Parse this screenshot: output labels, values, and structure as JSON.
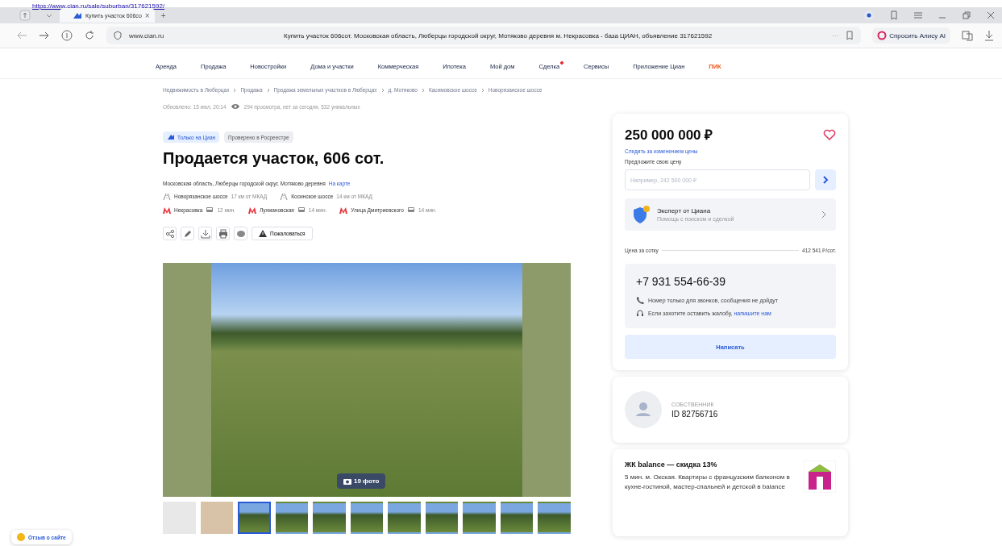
{
  "source_link": "https://www.cian.ru/sale/suburban/317621592/",
  "browser": {
    "tab": {
      "title": "Купить участок 606со",
      "close": "×"
    },
    "new_tab": "+",
    "url": "www.cian.ru",
    "page_title": "Купить участок 606сот. Московская область, Люберцы городской округ, Мотяково деревня м. Некрасовка - база ЦИАН, объявление 317621592",
    "more": "···",
    "alice": "Спросить Алису AI"
  },
  "nav": [
    {
      "label": "Аренда",
      "kind": "link",
      "dot": false
    },
    {
      "label": "Продажа",
      "kind": "link",
      "dot": false
    },
    {
      "label": "Новостройки",
      "kind": "link",
      "dot": false
    },
    {
      "label": "Дома и участки",
      "kind": "link",
      "dot": false
    },
    {
      "label": "Коммерческая",
      "kind": "link",
      "dot": false
    },
    {
      "label": "Ипотека",
      "kind": "link",
      "dot": false
    },
    {
      "label": "Мой дом",
      "kind": "link",
      "dot": false
    },
    {
      "label": "Сделка",
      "kind": "link",
      "dot": true
    },
    {
      "label": "Сервисы",
      "kind": "link",
      "dot": false
    },
    {
      "label": "Приложение Циан",
      "kind": "link",
      "dot": false
    },
    {
      "label": "ПИК",
      "kind": "brand",
      "dot": false
    }
  ],
  "breadcrumbs": [
    "Недвижимость в Люберцах",
    "Продажа",
    "Продажа земельных участков в Люберцах",
    "д. Мотяково",
    "Касимовское шоссе",
    "Новорязанское шоссе"
  ],
  "meta": {
    "updated": "Обновлено: 15 июл, 20:14",
    "views": "294 просмотра, нет за сегодня, 532 уникальных"
  },
  "tags": [
    {
      "label": "Только на Циан",
      "kind": "cian"
    },
    {
      "label": "Проверено в Росреестре",
      "kind": "plain"
    }
  ],
  "title": "Продается участок, 606 сот.",
  "address": {
    "text": "Московская область, Люберцы городской округ, Мотяково деревня",
    "map_link": "На карте"
  },
  "highways": [
    {
      "name": "Новорязанское шоссе",
      "distance": "17 км от МКАД"
    },
    {
      "name": "Косинское шоссе",
      "distance": "14 км от МКАД"
    }
  ],
  "metro": [
    {
      "station": "Некрасовка",
      "time": "12 мин."
    },
    {
      "station": "Лухмановская",
      "time": "14 мин."
    },
    {
      "station": "Улица Дмитриевского",
      "time": "14 мин."
    }
  ],
  "actions": {
    "complain": "Пожаловаться"
  },
  "gallery": {
    "count": "19 фото",
    "thumbnails": [
      {
        "kind": "document",
        "selected": false
      },
      {
        "kind": "plan",
        "selected": false
      },
      {
        "kind": "photo",
        "selected": true
      },
      {
        "kind": "photo",
        "selected": false
      },
      {
        "kind": "photo",
        "selected": false
      },
      {
        "kind": "photo",
        "selected": false
      },
      {
        "kind": "photo",
        "selected": false
      },
      {
        "kind": "photo",
        "selected": false
      },
      {
        "kind": "photo",
        "selected": false
      },
      {
        "kind": "photo",
        "selected": false
      },
      {
        "kind": "photo",
        "selected": false
      }
    ]
  },
  "price_card": {
    "price": "250 000 000 ₽",
    "favorite": false,
    "watch_link": "Следить за изменением цены",
    "offer_label": "Предложите свою цену",
    "offer_placeholder": "Например, 242 500 000 ₽",
    "expert_title": "Эксперт от Циана",
    "expert_subtitle": "Помощь с поиском и сделкой",
    "per_unit_label": "Цена за сотку",
    "per_unit_value": "412 541 ₽/сот.",
    "phone": "+7 931 554-66-39",
    "phone_note": "Номер только для звонков, сообщения не дойдут",
    "complaint_text": "Если захотите оставить жалобу,",
    "complaint_link": "напишите нам",
    "write_button": "Написать"
  },
  "owner": {
    "role": "СОБСТВЕННИК",
    "id": "ID 82756716"
  },
  "promo": {
    "title": "ЖК balance — скидка 13%",
    "text": "5 мин. м. Окская. Квартиры с французским балконом в кухне-гостиной, мастер-спальней и детской в balance"
  },
  "feedback": "Отзыв о сайте"
}
